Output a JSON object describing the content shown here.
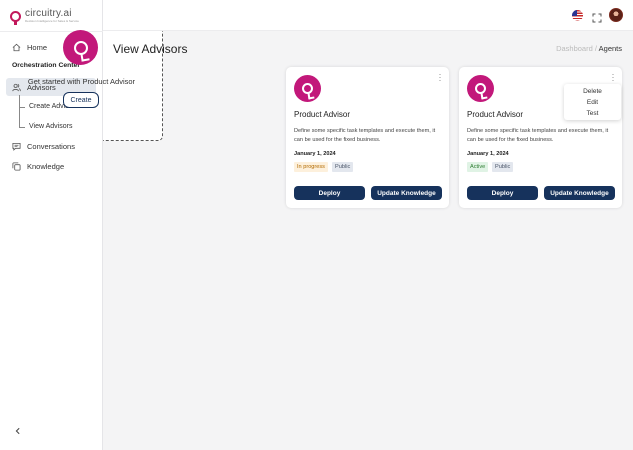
{
  "brand": {
    "name": "circuitry.ai",
    "tagline": "Decision Intelligence for Sales & Service",
    "color": "#c2185b"
  },
  "sidebar": {
    "home_label": "Home",
    "section_title": "Orchestration Center",
    "advisors_label": "Advisors",
    "create_advisor_label": "Create Advisor",
    "view_advisors_label": "View Advisors",
    "conversations_label": "Conversations",
    "knowledge_label": "Knowledge"
  },
  "page": {
    "title": "View Advisors",
    "breadcrumb_parent": "Dashboard",
    "breadcrumb_separator": "/",
    "breadcrumb_current": "Agents"
  },
  "create_card": {
    "caption": "Get started with Product Advisor",
    "button_label": "Create"
  },
  "agents": [
    {
      "name": "Product Advisor",
      "description": "Define some specific task templates and execute them, it can be used for the fixed business.",
      "date": "January 1, 2024",
      "status": "In progress",
      "visibility": "Public",
      "deploy_label": "Deploy",
      "update_label": "Update Knowledge"
    },
    {
      "name": "Product Advisor",
      "description": "Define some specific task templates and execute them, it can be used for the fixed business.",
      "date": "January 1, 2024",
      "status": "Active",
      "visibility": "Public",
      "deploy_label": "Deploy",
      "update_label": "Update Knowledge"
    }
  ],
  "context_menu": {
    "items": [
      "Delete",
      "Edit",
      "Test"
    ]
  },
  "colors": {
    "primary": "#16325c",
    "accent": "#c2187a",
    "in_progress_bg": "#fdf0dc",
    "active_bg": "#e0f3e5",
    "public_bg": "#e3e7ee"
  }
}
